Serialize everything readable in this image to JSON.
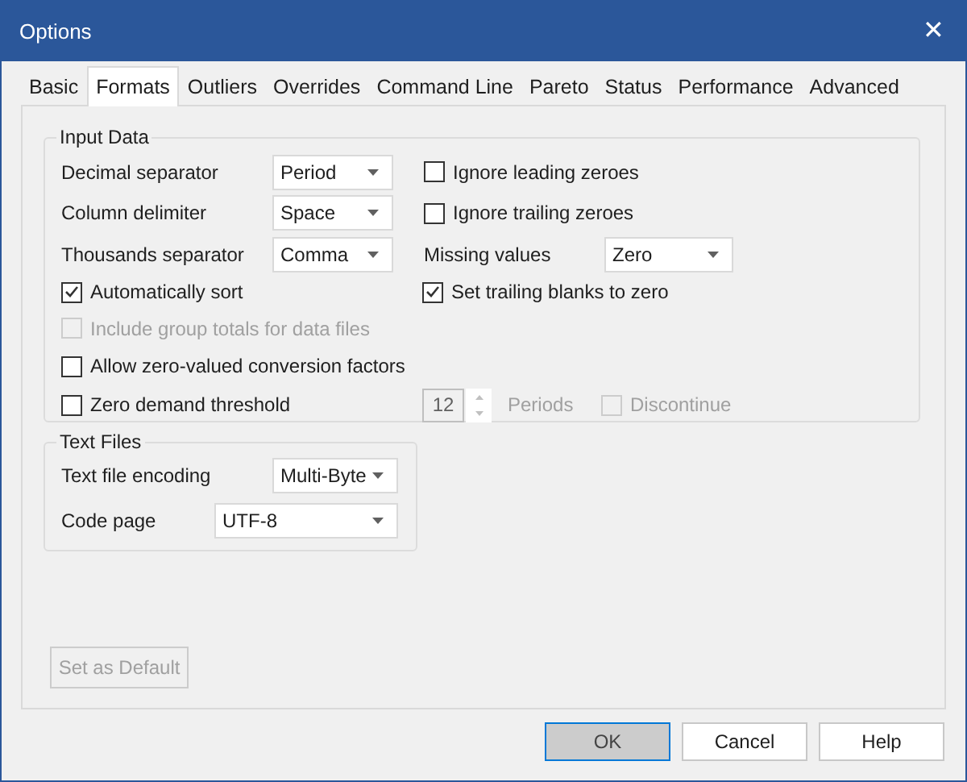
{
  "window": {
    "title": "Options",
    "close": "✕"
  },
  "tabs": [
    {
      "label": "Basic",
      "selected": false
    },
    {
      "label": "Formats",
      "selected": true
    },
    {
      "label": "Outliers",
      "selected": false
    },
    {
      "label": "Overrides",
      "selected": false
    },
    {
      "label": "Command Line",
      "selected": false
    },
    {
      "label": "Pareto",
      "selected": false
    },
    {
      "label": "Status",
      "selected": false
    },
    {
      "label": "Performance",
      "selected": false
    },
    {
      "label": "Advanced",
      "selected": false
    }
  ],
  "input_data": {
    "legend": "Input Data",
    "selects": [
      {
        "label": "Decimal separator",
        "value": "Period"
      },
      {
        "label": "Column delimiter",
        "value": "Space"
      },
      {
        "label": "Thousands separator",
        "value": "Comma"
      }
    ],
    "right_checkboxes": [
      {
        "label": "Ignore leading zeroes",
        "checked": false
      },
      {
        "label": "Ignore trailing zeroes",
        "checked": false
      }
    ],
    "missing_values": {
      "label": "Missing values",
      "value": "Zero"
    },
    "set_trailing_blanks": {
      "label": "Set trailing blanks to zero",
      "checked": true
    },
    "options": [
      {
        "label": "Automatically sort",
        "checked": true,
        "disabled": false
      },
      {
        "label": "Include group totals for data files",
        "checked": false,
        "disabled": true
      },
      {
        "label": "Allow zero-valued conversion factors",
        "checked": false,
        "disabled": false
      },
      {
        "label": "Zero demand threshold",
        "checked": false,
        "disabled": false
      }
    ],
    "periods": {
      "value": "12",
      "label": "Periods",
      "disabled": true
    },
    "discontinue": {
      "label": "Discontinue",
      "checked": false,
      "disabled": true
    }
  },
  "text_files": {
    "legend": "Text Files",
    "encoding": {
      "label": "Text file encoding",
      "value": "Multi-Byte"
    },
    "code_page": {
      "label": "Code page",
      "value": "UTF-8"
    }
  },
  "set_default": {
    "label": "Set as Default",
    "disabled": true
  },
  "buttons": [
    {
      "label": "OK",
      "default": true
    },
    {
      "label": "Cancel",
      "default": false
    },
    {
      "label": "Help",
      "default": false
    }
  ]
}
